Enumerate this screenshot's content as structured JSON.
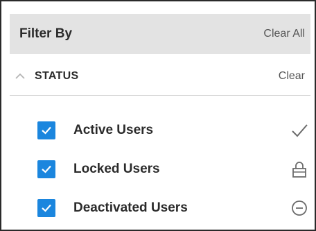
{
  "header": {
    "title": "Filter By",
    "clear_all_label": "Clear All"
  },
  "section": {
    "title": "STATUS",
    "clear_label": "Clear",
    "expanded": true
  },
  "options": [
    {
      "label": "Active Users",
      "checked": true,
      "icon": "checkmark-icon"
    },
    {
      "label": "Locked Users",
      "checked": true,
      "icon": "lock-icon"
    },
    {
      "label": "Deactivated Users",
      "checked": true,
      "icon": "minus-circle-icon"
    }
  ],
  "colors": {
    "accent": "#1b86de",
    "header_bg": "#e3e3e3",
    "icon_gray": "#6b6b6b"
  }
}
